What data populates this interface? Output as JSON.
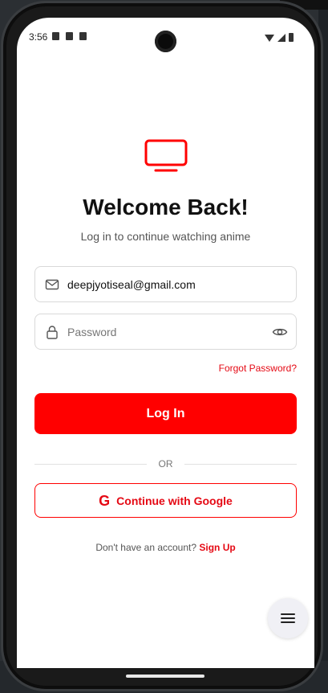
{
  "status_bar": {
    "time": "3:56"
  },
  "header": {
    "title": "Welcome Back!",
    "subtitle": "Log in to continue watching anime",
    "logo_icon": "tv-icon"
  },
  "form": {
    "email": {
      "value": "deepjyotiseal@gmail.com",
      "icon": "mail-icon"
    },
    "password": {
      "value": "",
      "placeholder": "Password",
      "icon": "lock-icon",
      "toggle_icon": "eye-icon"
    },
    "forgot_label": "Forgot Password?",
    "login_label": "Log In",
    "divider_label": "OR",
    "google_label": "Continue with Google",
    "google_icon": "G"
  },
  "footer": {
    "prompt": "Don't have an account? ",
    "signup_label": "Sign Up"
  },
  "fab": {
    "icon": "menu-icon"
  },
  "colors": {
    "accent": "#ff0000",
    "accent_text": "#e50914",
    "background": "#ffffff"
  }
}
